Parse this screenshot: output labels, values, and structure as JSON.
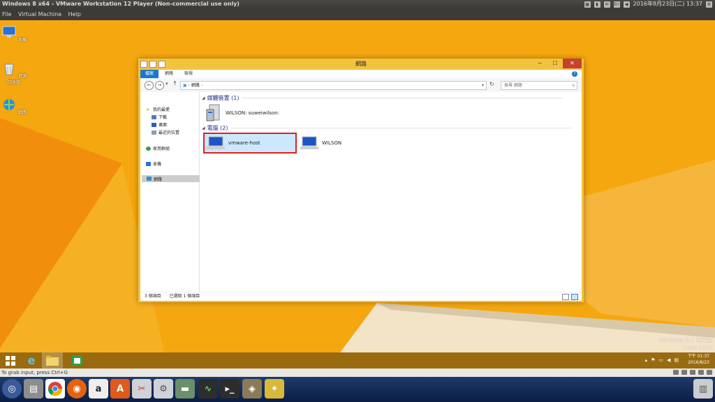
{
  "host": {
    "window_title": "Windows 8 x64 - VMware Workstation 12 Player (Non-commercial use only)",
    "tray_keyboard": "En",
    "datetime": "2016年8月23日(二) 13:37",
    "menu": [
      "File",
      "Virtual Machine",
      "Help"
    ],
    "status_hint": "To grab input, press Ctrl+G"
  },
  "desktop": {
    "icons": [
      "本機",
      "資源回收筒",
      "網路"
    ],
    "watermark_line1": "Windows 8.1 專業版",
    "watermark_line2": "Build 9600"
  },
  "explorer": {
    "title": "網路",
    "ribbon_tabs": [
      "檔案",
      "網路",
      "檢視"
    ],
    "address_path": "網路",
    "search_placeholder": "搜尋 網路",
    "sidebar": {
      "favorites": "我的最愛",
      "downloads": "下載",
      "desktop": "桌面",
      "recent": "最近的位置",
      "homegroup": "家用群組",
      "thispc": "本機",
      "network": "網路"
    },
    "groups": [
      {
        "label": "媒體裝置 (1)",
        "items": [
          "WILSON: suweiwilson:"
        ]
      },
      {
        "label": "電腦 (2)",
        "items": [
          "vmware-host",
          "WILSON"
        ]
      }
    ],
    "status": {
      "count": "3 個項目",
      "selected": "已選取 1 個項目"
    }
  },
  "taskbar": {
    "clock_time": "下午 01:37",
    "clock_date": "2016/8/23"
  },
  "colors": {
    "desktop": "#f5a70f",
    "window_frame": "#f2c43e",
    "ribbon_accent": "#1979ca",
    "selection": "#cce8ff",
    "highlight_box": "#e0201e",
    "dock": "#0b1e45"
  }
}
